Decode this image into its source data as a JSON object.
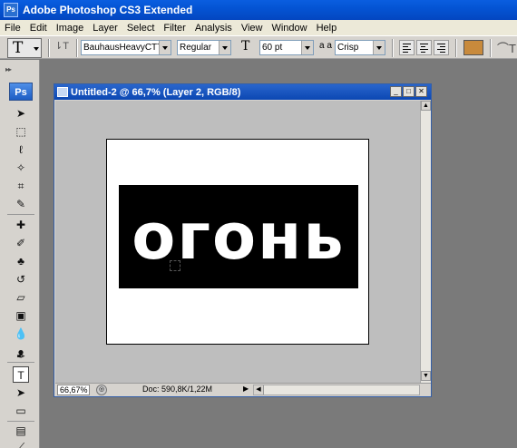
{
  "app": {
    "icon_label": "Ps",
    "title": "Adobe Photoshop CS3 Extended"
  },
  "menu": [
    "File",
    "Edit",
    "Image",
    "Layer",
    "Select",
    "Filter",
    "Analysis",
    "View",
    "Window",
    "Help"
  ],
  "options": {
    "tool_preset_glyph": "T",
    "orientation_glyph": "⇂T",
    "font_family": "BauhausHeavyCTT",
    "font_style": "Regular",
    "font_size_glyph": "T",
    "font_size": "60 pt",
    "antialias_glyph": "a a",
    "antialias": "Crisp",
    "text_color": "#c88a3c"
  },
  "toolbox": {
    "logo": "Ps"
  },
  "document": {
    "title": "Untitled-2 @ 66,7% (Layer 2, RGB/8)",
    "canvas_text": "огонь",
    "zoom": "66,67%",
    "doc_info": "Doc: 590,8K/1,22M"
  }
}
